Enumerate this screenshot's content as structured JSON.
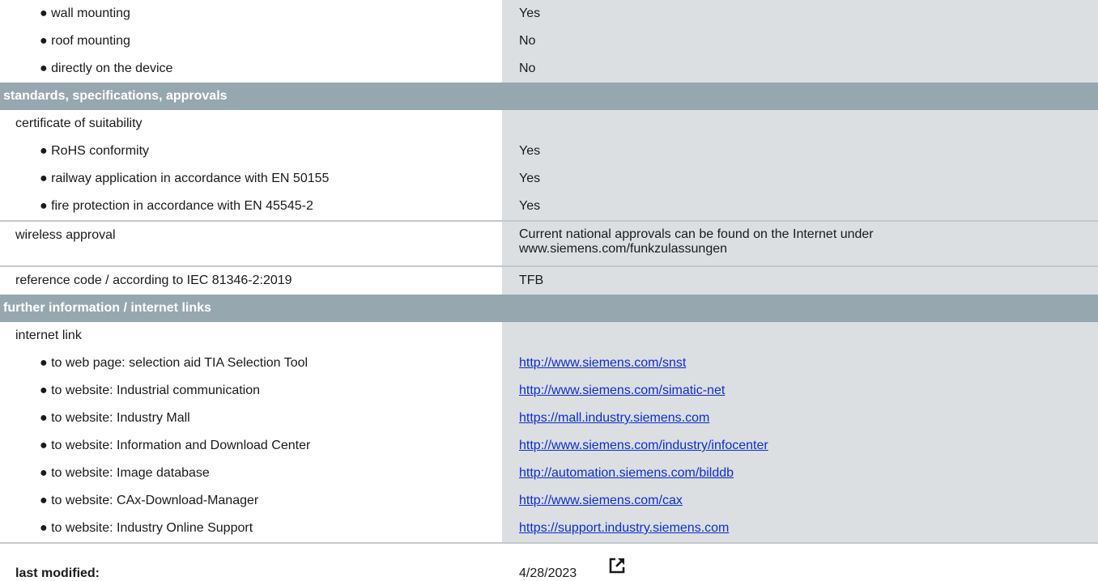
{
  "mounting": {
    "wall": {
      "label": "● wall mounting",
      "value": "Yes"
    },
    "roof": {
      "label": "● roof mounting",
      "value": "No"
    },
    "device": {
      "label": "● directly on the device",
      "value": "No"
    }
  },
  "standards": {
    "header": "standards, specifications, approvals",
    "certificate_label": "certificate of suitability",
    "rohs": {
      "label": "● RoHS conformity",
      "value": "Yes"
    },
    "railway": {
      "label": "● railway application in accordance with EN 50155",
      "value": "Yes"
    },
    "fire": {
      "label": "● fire protection in accordance with EN 45545-2",
      "value": "Yes"
    },
    "wireless": {
      "label": "wireless approval",
      "value_line1": "Current national approvals can be found on the Internet under",
      "value_line2": "www.siemens.com/funkzulassungen"
    },
    "refcode": {
      "label": "reference code / according to IEC 81346-2:2019",
      "value": "TFB"
    }
  },
  "further": {
    "header": "further information / internet links",
    "internet_label": "internet link",
    "links": [
      {
        "label": "● to web page: selection aid TIA Selection Tool",
        "url": "http://www.siemens.com/snst"
      },
      {
        "label": "● to website: Industrial communication",
        "url": "http://www.siemens.com/simatic-net"
      },
      {
        "label": "● to website: Industry Mall",
        "url": "https://mall.industry.siemens.com"
      },
      {
        "label": "● to website: Information and Download Center",
        "url": "http://www.siemens.com/industry/infocenter"
      },
      {
        "label": "● to website: Image database",
        "url": "http://automation.siemens.com/bilddb"
      },
      {
        "label": "● to website: CAx-Download-Manager",
        "url": "http://www.siemens.com/cax"
      },
      {
        "label": "● to website: Industry Online Support",
        "url": "https://support.industry.siemens.com"
      }
    ]
  },
  "footer": {
    "label": "last modified:",
    "date": "4/28/2023",
    "icon": "external-link-icon"
  }
}
